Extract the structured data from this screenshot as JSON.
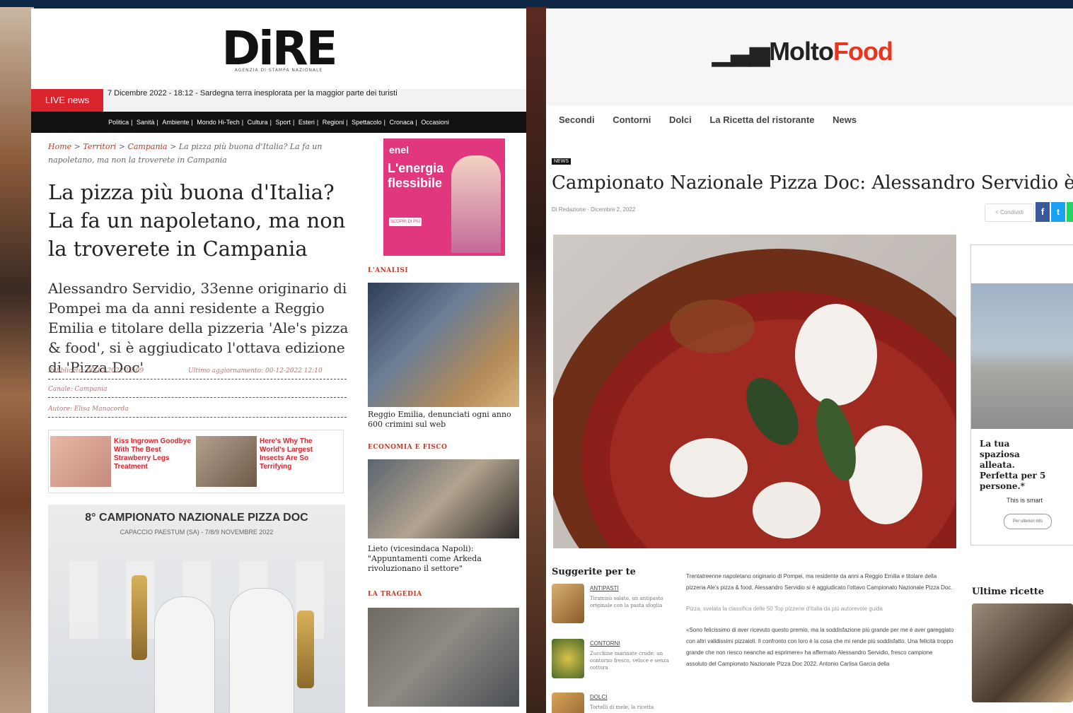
{
  "dire": {
    "logo": "DiRE",
    "logo_sub": "AGENZIA DI STAMPA NAZIONALE",
    "live_badge": "LIVE news",
    "live_text": "7 Dicembre 2022 - 18:12 - Sardegna terra inesplorata per la maggior parte dei turisti",
    "nav": [
      "Politica",
      "Sanità",
      "Ambiente",
      "Mondo Hi-Tech",
      "Cultura",
      "Sport",
      "Esteri",
      "Regioni",
      "Spettacolo",
      "Cronaca",
      "Occasioni"
    ],
    "breadcrumb": {
      "home": "Home",
      "territori": "Territori",
      "campania": "Campania",
      "current": "La pizza più buona d'Italia? La fa un napoletano, ma non la troverete in Campania"
    },
    "title": "La pizza più buona d'Italia? La fa un napoletano, ma non la troverete in Campania",
    "lead": "Alessandro Servidio, 33enne originario di Pompei ma da anni residente a Reggio Emilia e titolare della pizzeria 'Ale's pizza & food', si è aggiudicato l'ottava edizione di 'Pizza Doc'",
    "meta_published": "Pubblicato: 00-12-2022 12:09",
    "meta_updated": "Ultimo aggiornamento: 00-12-2022 12:10",
    "meta_canale": "Canale: Campania",
    "meta_autore": "Autore: Elisa Manacorda",
    "ads": [
      {
        "text": "Kiss Ingrown Goodbye With The Best Strawberry Legs Treatment"
      },
      {
        "text": "Here's Why The World's Largest Insects Are So Terrifying"
      }
    ],
    "photo_title": "8° CAMPIONATO NAZIONALE PIZZA DOC",
    "photo_sub": "CAPACCIO PAESTUM (SA) - 7/8/9 NOVEMBRE 2022",
    "enel_logo": "enel",
    "enel_headline": "L'energia flessibile",
    "enel_btn": "SCOPRI DI PIÙ",
    "sidebar": [
      {
        "label": "L'ANALISI",
        "caption": "Reggio Emilia, denunciati ogni anno 600 crimini sul web"
      },
      {
        "label": "ECONOMIA E FISCO",
        "caption": "Lieto (vicesindaca Napoli): \"Appuntamenti come Arkeda rivoluzionano il settore\""
      },
      {
        "label": "LA TRAGEDIA",
        "caption": ""
      }
    ]
  },
  "molto": {
    "logo_prefix": "Molto",
    "logo_suffix": "Food",
    "nav": [
      "Secondi",
      "Contorni",
      "Dolci",
      "La Ricetta del ristorante",
      "News"
    ],
    "tag": "NEWS",
    "title": "Campionato Nazionale Pizza Doc: Alessandro Servidio è il vincitore",
    "byline": "Di Redazione  ·  Dicembre 2, 2022",
    "share": "Condividi",
    "fb": "f",
    "tw": "t",
    "side_ad_text": "La tua spaziosa alleata. Perfetta per 5 persone.*",
    "side_ad_brand": "This is smart",
    "side_ad_btn": "Per ulteriori info",
    "suggerite_title": "Suggerite per te",
    "suggerite": [
      {
        "cat": "ANTIPASTI",
        "text": "Tiramisù salato, un antipasto originale con la pasta sfoglia"
      },
      {
        "cat": "CONTORNI",
        "text": "Zucchine marinate crude: un contorno fresco, veloce e senza cottura"
      },
      {
        "cat": "DOLCI",
        "text": "Tortelli di mele, la ricetta"
      }
    ],
    "body": [
      "Trentatreenne napoletano originario di Pompei, ma residente da anni a Reggio Emilia e titolare della pizzeria Ale's pizza & food, Alessandro Servidio si è aggiudicato l'ottavo Campionato Nazionale Pizza Doc.",
      "Pizza, svelata la classifica delle 50 Top pizzerie d'Italia da più autorevole guida",
      "«Sono felicissimo di aver ricevuto questo premio, ma la soddisfazione più grande per me è aver gareggiato con altri validissimi pizzaioli. Il confronto con loro è la cosa che mi rende più soddisfatto. Una felicità troppo grande che non riesco neanche ad esprimere» ha affermato Alessandro Servidio, fresco campione assoluto del Campionato Nazionale Pizza Doc 2022. Antonio Carlisa Garcia della"
    ],
    "ultime_title": "Ultime ricette"
  }
}
